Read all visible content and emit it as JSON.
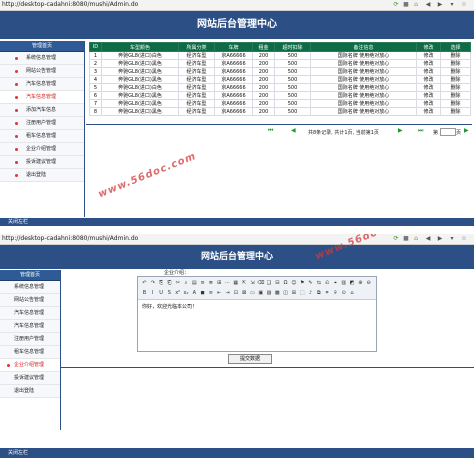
{
  "window1": {
    "url": "http://desktop-cadahni:8080/mushi/Admin.do",
    "header_title": "网站后台管理中心",
    "sidebar": {
      "title": "管理首页",
      "items": [
        {
          "label": "系统信息管理"
        },
        {
          "label": "网站公告管理"
        },
        {
          "label": "汽车信息管理"
        },
        {
          "label": "汽车信息管理"
        },
        {
          "label": "添加汽车信息"
        },
        {
          "label": "注册用户管理"
        },
        {
          "label": "租车信息管理"
        },
        {
          "label": "企业介绍管理"
        },
        {
          "label": "投诉建议管理"
        },
        {
          "label": "退出登陆"
        }
      ]
    },
    "table": {
      "columns": [
        "ID",
        "车型颜色",
        "所属分类",
        "车牌",
        "租金",
        "超时扣除",
        "备注信息",
        "修改",
        "选择"
      ],
      "rows": [
        [
          "1",
          "奔驰GL8(进口)白色",
          "经济车型",
          "京A66666",
          "200",
          "500",
          "国际名牌 使用绝对放心",
          "修改",
          "删除"
        ],
        [
          "2",
          "奔驰GL8(进口)黑色",
          "经济车型",
          "京A66666",
          "200",
          "500",
          "国际名牌 使用绝对放心",
          "修改",
          "删除"
        ],
        [
          "3",
          "奔驰GL8(进口)黑色",
          "经济车型",
          "京A66666",
          "200",
          "500",
          "国际名牌 使用绝对放心",
          "修改",
          "删除"
        ],
        [
          "4",
          "奔驰GL8(进口)黑色",
          "经济车型",
          "京A66666",
          "200",
          "500",
          "国际名牌 使用绝对放心",
          "修改",
          "删除"
        ],
        [
          "5",
          "奔驰GL8(进口)白色",
          "经济车型",
          "京A66666",
          "200",
          "500",
          "国际名牌 使用绝对放心",
          "修改",
          "删除"
        ],
        [
          "6",
          "奔驰GL8(进口)黑色",
          "经济车型",
          "京A66666",
          "200",
          "500",
          "国际名牌 使用绝对放心",
          "修改",
          "删除"
        ],
        [
          "7",
          "奔驰GL8(进口)黑色",
          "经济车型",
          "京A66666",
          "200",
          "500",
          "国际名牌 使用绝对放心",
          "修改",
          "删除"
        ],
        [
          "8",
          "奔驰GL8(进口)黑色",
          "经济车型",
          "京A66666",
          "200",
          "500",
          "国际名牌 使用绝对放心",
          "修改",
          "删除"
        ]
      ]
    },
    "pager": {
      "summary": "共8条记录, 共计1页, 当前第1页",
      "page_prefix": "第",
      "page_suffix": "页"
    },
    "footer": "关闭左栏",
    "watermark": "www.56doc.com"
  },
  "window2": {
    "url": "http://desktop-cadahni:8080/mushi/Admin.do",
    "header_title": "网站后台管理中心",
    "sidebar": {
      "title": "管理首页",
      "items": [
        {
          "label": "系统信息管理"
        },
        {
          "label": "网站公告管理"
        },
        {
          "label": "汽车信息管理"
        },
        {
          "label": "汽车信息管理"
        },
        {
          "label": "注册用户管理"
        },
        {
          "label": "租车信息管理"
        },
        {
          "label": "企业介绍管理"
        },
        {
          "label": "投诉建议管理"
        },
        {
          "label": "退出登陆"
        }
      ]
    },
    "form_label": "企业介绍：",
    "editor_content": "你好，欢迎光临本公司！",
    "submit_label": "提交数据",
    "footer": "关闭左栏",
    "watermark": "www.56doc.com"
  },
  "colors": {
    "header": "#2c4f86",
    "table_header": "#0d6b45",
    "selected": "#d21f1f",
    "pager_icon": "#1a9a2a"
  },
  "icons": [
    "page-first-icon",
    "page-prev-icon",
    "page-next-icon",
    "page-last-icon",
    "page-go-icon",
    "menu-bullet-icon"
  ]
}
